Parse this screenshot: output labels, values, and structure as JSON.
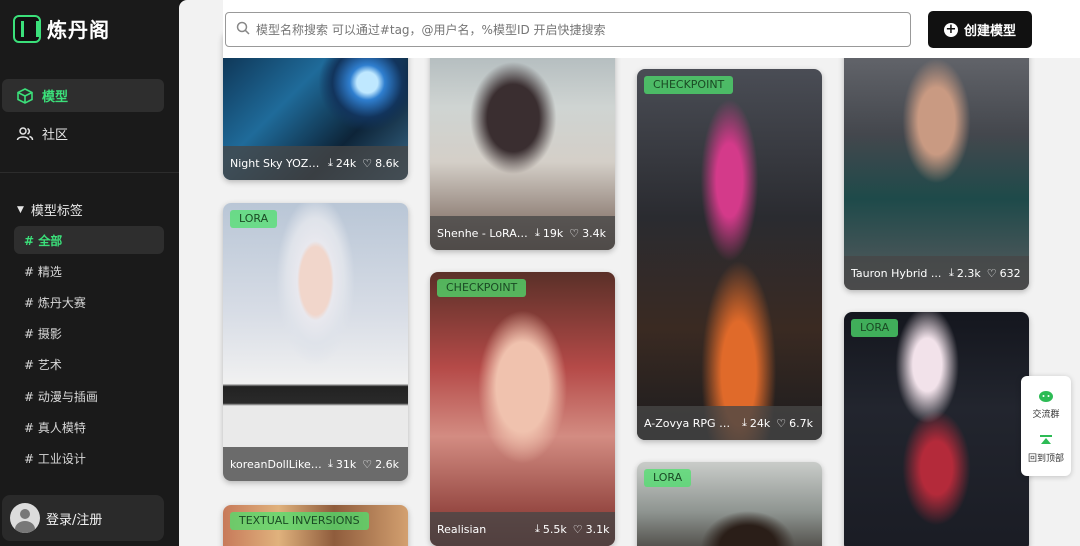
{
  "logo": {
    "text": "炼丹阁"
  },
  "nav": [
    {
      "label": "模型",
      "icon": "cube-icon",
      "active": true
    },
    {
      "label": "社区",
      "icon": "users-icon",
      "active": false
    }
  ],
  "tags": {
    "header": "模型标签",
    "items": [
      {
        "label": "# 全部",
        "active": true
      },
      {
        "label": "# 精选"
      },
      {
        "label": "# 炼丹大赛"
      },
      {
        "label": "# 摄影"
      },
      {
        "label": "# 艺术"
      },
      {
        "label": "# 动漫与插画"
      },
      {
        "label": "# 真人模特"
      },
      {
        "label": "# 工业设计"
      }
    ]
  },
  "login": {
    "label": "登录/注册"
  },
  "search": {
    "placeholder": "模型名称搜索 可以通过#tag，@用户名，%模型ID 开启快捷搜索"
  },
  "create_button": {
    "label": "创建模型"
  },
  "cards": [
    {
      "title": "Night Sky YOZO...",
      "downloads": "24k",
      "likes": "8.6k",
      "badge": ""
    },
    {
      "title": "koreanDollLiken...",
      "downloads": "31k",
      "likes": "2.6k",
      "badge": "LORA"
    },
    {
      "title": "",
      "downloads": "",
      "likes": "",
      "badge": "TEXTUAL INVERSIONS"
    },
    {
      "title": "Shenhe - LoRA ...",
      "downloads": "19k",
      "likes": "3.4k",
      "badge": ""
    },
    {
      "title": "Realisian",
      "downloads": "5.5k",
      "likes": "3.1k",
      "badge": "CHECKPOINT"
    },
    {
      "title": "A-Zovya RPG Ar...",
      "downloads": "24k",
      "likes": "6.7k",
      "badge": "CHECKPOINT"
    },
    {
      "title": "",
      "downloads": "",
      "likes": "",
      "badge": "LORA"
    },
    {
      "title": "Tauron Hybrid ...",
      "downloads": "2.3k",
      "likes": "632",
      "badge": ""
    },
    {
      "title": "",
      "downloads": "",
      "likes": "",
      "badge": "LORA"
    }
  ],
  "float": {
    "chat": "交流群",
    "top": "回到顶部"
  },
  "colors": {
    "accent": "#3be07a",
    "sidebar": "#1a1a1a",
    "badge": "#4fe06e"
  }
}
